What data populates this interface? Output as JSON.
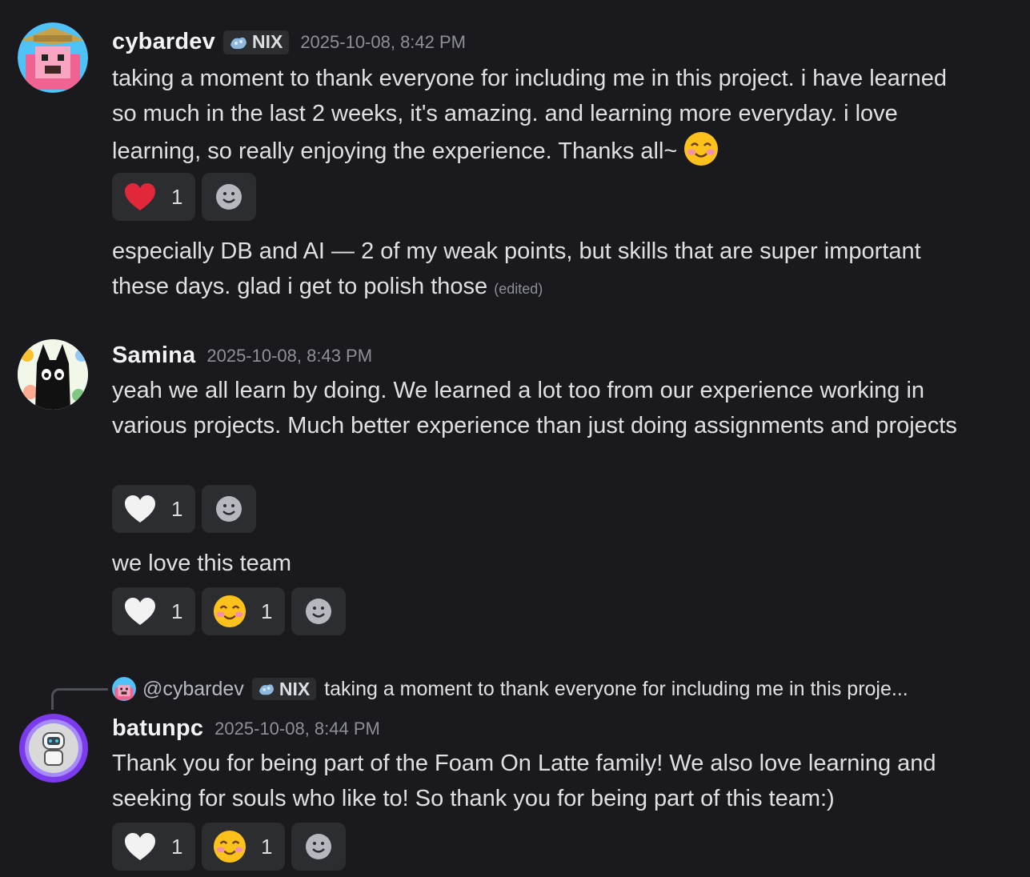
{
  "messages": [
    {
      "username": "cybardev",
      "tag": "NIX",
      "timestamp": "2025-10-08, 8:42 PM",
      "paragraphs": [
        "taking a moment to thank everyone for including me in this project. i have learned so much in the last 2 weeks, it's amazing. and learning more everyday. i love learning, so really enjoying the experience. Thanks all~"
      ],
      "reactions_1": [
        {
          "emoji": "red-heart-icon",
          "count": "1"
        }
      ],
      "followup": "especially DB and AI — 2 of my weak points, but skills that are super important these days. glad i get to polish those",
      "edited_label": "(edited)"
    },
    {
      "username": "Samina",
      "timestamp": "2025-10-08, 8:43 PM",
      "text": "yeah we all learn by doing. We learned a lot too from our experience working in various projects. Much better experience than just doing assignments and projects",
      "reactions_1": [
        {
          "emoji": "white-heart-icon",
          "count": "1"
        }
      ],
      "followup": "we love this team",
      "reactions_2": [
        {
          "emoji": "white-heart-icon",
          "count": "1"
        },
        {
          "emoji": "smiling-face-icon",
          "count": "1"
        }
      ]
    },
    {
      "reply": {
        "username": "@cybardev",
        "tag": "NIX",
        "snippet": "taking a moment to thank everyone for including me in this proje..."
      },
      "username": "batunpc",
      "timestamp": "2025-10-08, 8:44 PM",
      "text": "Thank you for being part of the Foam On Latte family! We also love learning and seeking for souls who like to! So thank you for being part of this team:)",
      "reactions_1": [
        {
          "emoji": "white-heart-icon",
          "count": "1"
        },
        {
          "emoji": "smiling-face-icon",
          "count": "1"
        }
      ]
    }
  ],
  "colors": {
    "background": "#1a1a1e",
    "pill": "#2b2d31",
    "text": "#dfe0e3",
    "muted": "#8e9097",
    "heart_red": "#e0283a"
  }
}
